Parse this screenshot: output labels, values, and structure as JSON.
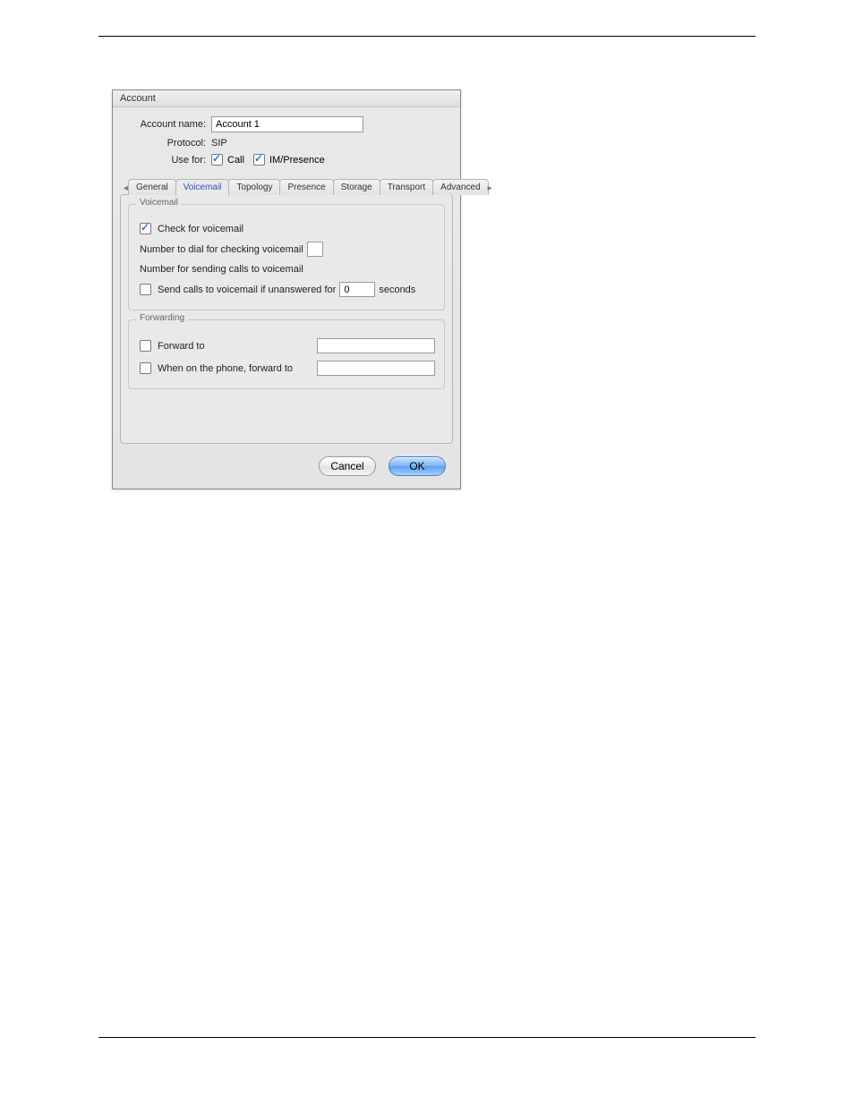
{
  "window": {
    "title": "Account"
  },
  "header": {
    "account_name_label": "Account name:",
    "account_name_value": "Account 1",
    "protocol_label": "Protocol:",
    "protocol_value": "SIP",
    "use_for_label": "Use for:",
    "use_for_options": {
      "call": {
        "label": "Call",
        "checked": true
      },
      "im": {
        "label": "IM/Presence",
        "checked": true
      }
    }
  },
  "tabs": {
    "general": "General",
    "voicemail": "Voicemail",
    "topology": "Topology",
    "presence": "Presence",
    "storage": "Storage",
    "transport": "Transport",
    "advanced": "Advanced",
    "active": "voicemail"
  },
  "voicemail_group": {
    "legend": "Voicemail",
    "check_label": "Check for voicemail",
    "check_checked": true,
    "dial_label": "Number to dial for checking voicemail",
    "dial_value": "",
    "send_label": "Number for sending calls to voicemail",
    "send_value": "",
    "unanswered_checked": false,
    "unanswered_prefix": "Send calls to voicemail if unanswered for",
    "unanswered_value": "0",
    "unanswered_suffix": "seconds"
  },
  "forwarding_group": {
    "legend": "Forwarding",
    "forward_checked": false,
    "forward_label": "Forward to",
    "forward_value": "",
    "onphone_checked": false,
    "onphone_label": "When on the phone, forward to",
    "onphone_value": ""
  },
  "buttons": {
    "cancel": "Cancel",
    "ok": "OK"
  }
}
